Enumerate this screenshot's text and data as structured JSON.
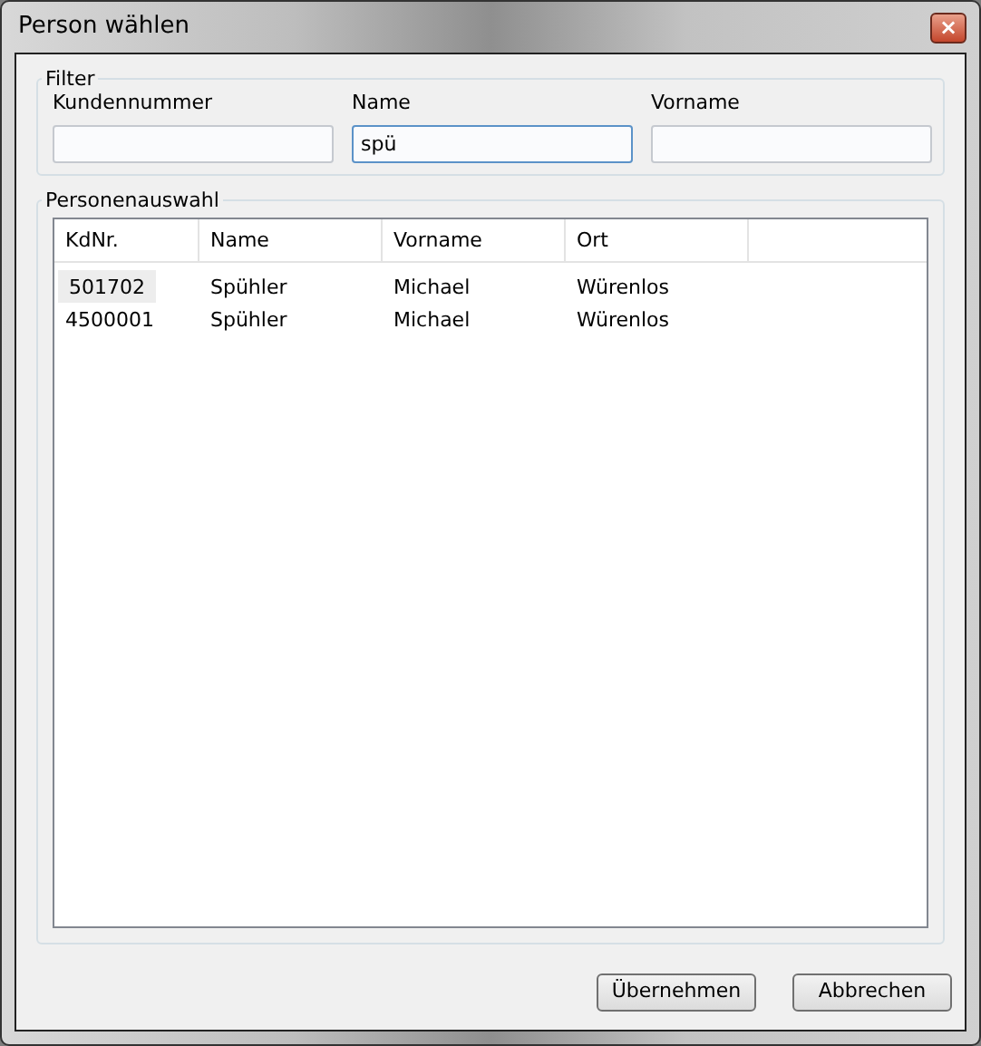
{
  "window": {
    "title": "Person wählen",
    "close": "×"
  },
  "filter": {
    "legend": "Filter",
    "fields": [
      {
        "label": "Kundennummer",
        "focused": false
      },
      {
        "label": "Name",
        "value": "spü",
        "focused": true
      },
      {
        "label": "Vorname",
        "focused": false
      }
    ]
  },
  "selection": {
    "legend": "Personenauswahl",
    "columns": [
      "KdNr.",
      "Name",
      "Vorname",
      "Ort"
    ],
    "rows": [
      {
        "cells": [
          "501702",
          "Spühler",
          "Michael",
          "Würenlos"
        ],
        "selected": true
      },
      {
        "cells": [
          "4500001",
          "Spühler",
          "Michael",
          "Würenlos"
        ],
        "selected": false
      }
    ]
  },
  "buttons": [
    "Übernehmen",
    "Abbrechen"
  ]
}
